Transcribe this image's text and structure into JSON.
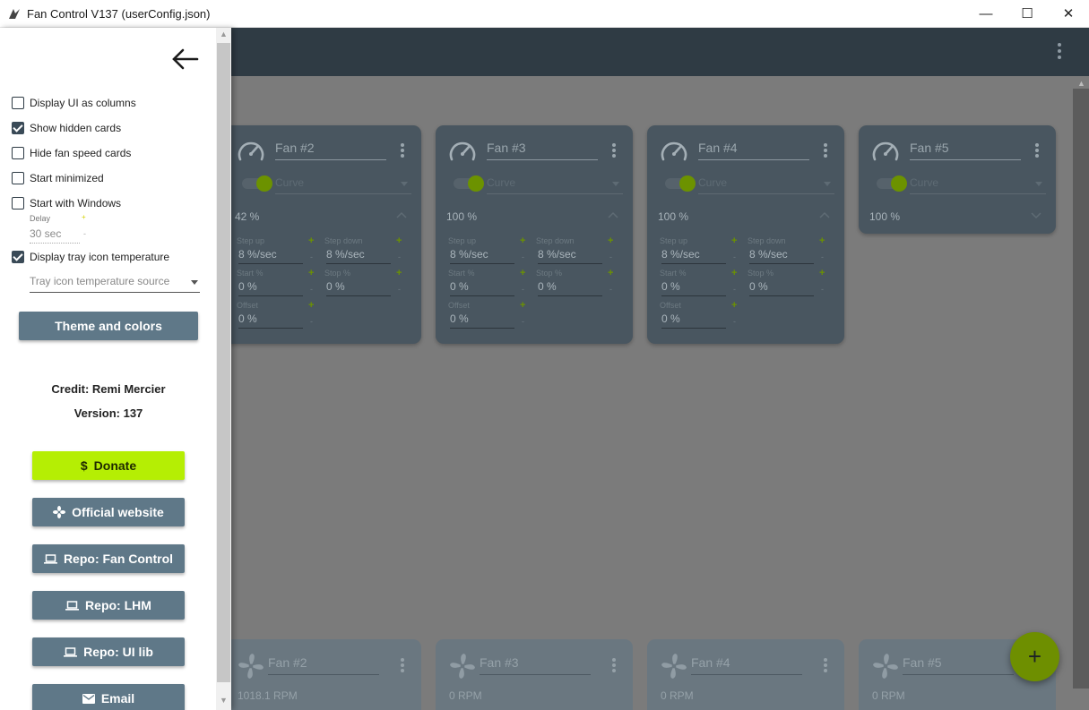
{
  "window": {
    "title": "Fan Control V137 (userConfig.json)",
    "minimize": "—",
    "maximize": "☐",
    "close": "✕"
  },
  "settings": {
    "options": [
      {
        "label": "Display UI as columns",
        "checked": false
      },
      {
        "label": "Show hidden cards",
        "checked": true
      },
      {
        "label": "Hide fan speed cards",
        "checked": false
      },
      {
        "label": "Start minimized",
        "checked": false
      },
      {
        "label": "Start with Windows",
        "checked": false
      },
      {
        "label": "Display tray icon temperature",
        "checked": true
      }
    ],
    "delay": {
      "label": "Delay",
      "value": "30 sec",
      "plus": "+",
      "minus": "-"
    },
    "tray_source_placeholder": "Tray icon temperature source",
    "theme_button": "Theme and colors",
    "credit": "Credit: Remi Mercier",
    "version": "Version: 137",
    "buttons": {
      "donate": "Donate",
      "website": "Official website",
      "repo_fan_control": "Repo: Fan Control",
      "repo_lhm": "Repo: LHM",
      "repo_ui_lib": "Repo: UI lib",
      "email": "Email"
    }
  },
  "control_cards": [
    {
      "name": "Fan #2",
      "curve": "Curve",
      "percent": "42 %",
      "expanded": true,
      "step_up": "8 %/sec",
      "step_down": "8 %/sec",
      "start": "0 %",
      "stop": "0 %",
      "offset": "0 %"
    },
    {
      "name": "Fan #3",
      "curve": "Curve",
      "percent": "100 %",
      "expanded": true,
      "step_up": "8 %/sec",
      "step_down": "8 %/sec",
      "start": "0 %",
      "stop": "0 %",
      "offset": "0 %"
    },
    {
      "name": "Fan #4",
      "curve": "Curve",
      "percent": "100 %",
      "expanded": true,
      "step_up": "8 %/sec",
      "step_down": "8 %/sec",
      "start": "0 %",
      "stop": "0 %",
      "offset": "0 %"
    },
    {
      "name": "Fan #5",
      "curve": "Curve",
      "percent": "100 %",
      "expanded": false
    }
  ],
  "field_labels": {
    "step_up": "Step up",
    "step_down": "Step down",
    "start": "Start %",
    "stop": "Stop %",
    "offset": "Offset",
    "plus": "+",
    "minus": "-"
  },
  "speed_cards": [
    {
      "name": "Fan #2",
      "rpm": "1018.1 RPM"
    },
    {
      "name": "Fan #3",
      "rpm": "0 RPM"
    },
    {
      "name": "Fan #4",
      "rpm": "0 RPM"
    },
    {
      "name": "Fan #5",
      "rpm": "0 RPM"
    }
  ],
  "fab": "+",
  "colors": {
    "accent": "#b5ee04",
    "header": "#2f3b44",
    "card": "#495660",
    "button": "#5f7888"
  }
}
